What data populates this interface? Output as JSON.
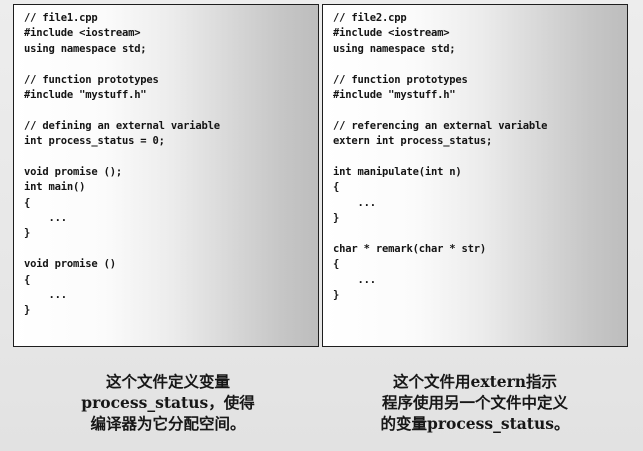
{
  "panels": {
    "file1": {
      "code_lines": [
        "// file1.cpp",
        "#include <iostream>",
        "using namespace std;",
        "",
        "// function prototypes",
        "#include \"mystuff.h\"",
        "",
        "// defining an external variable",
        "int process_status = 0;",
        "",
        "void promise ();",
        "int main()",
        "{",
        "    ...",
        "}",
        "",
        "void promise ()",
        "{",
        "    ...",
        "}"
      ]
    },
    "file2": {
      "code_lines": [
        "// file2.cpp",
        "#include <iostream>",
        "using namespace std;",
        "",
        "// function prototypes",
        "#include \"mystuff.h\"",
        "",
        "// referencing an external variable",
        "extern int process_status;",
        "",
        "int manipulate(int n)",
        "{",
        "    ...",
        "}",
        "",
        "char * remark(char * str)",
        "{",
        "    ...",
        "}"
      ]
    }
  },
  "captions": {
    "file1": [
      "这个文件定义变量",
      "process_status，使得",
      "编译器为它分配空间。"
    ],
    "file2": [
      "这个文件用extern指示",
      "程序使用另一个文件中定义",
      "的变量process_status。"
    ]
  }
}
